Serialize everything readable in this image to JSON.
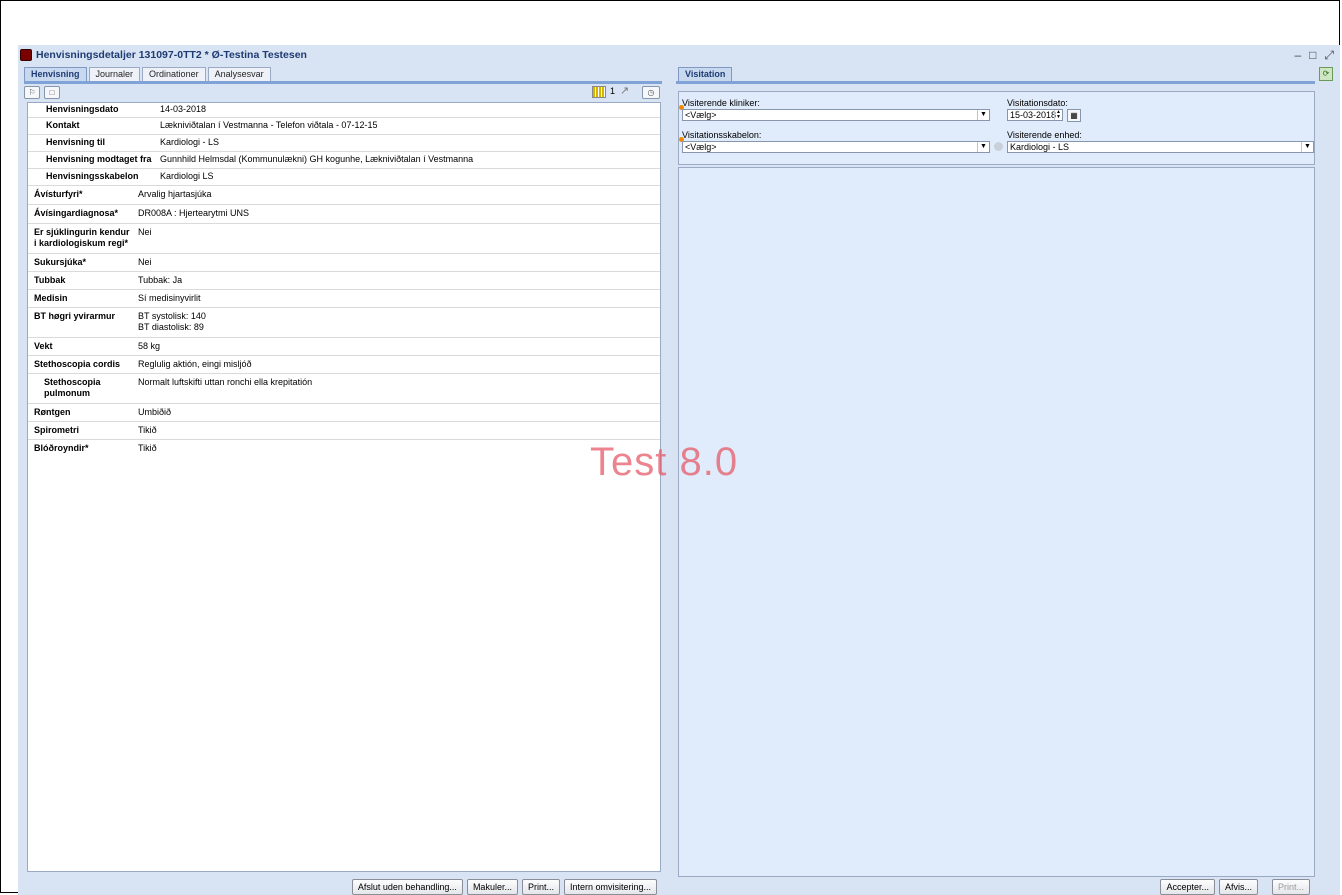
{
  "window": {
    "title": "Henvisningsdetaljer 131097-0TT2 * Ø-Testina Testesen",
    "controls": [
      "–",
      "□",
      "⤢"
    ]
  },
  "left_tabs": [
    "Henvisning",
    "Journaler",
    "Ordinationer",
    "Analysesvar"
  ],
  "right_tabs": [
    "Visitation"
  ],
  "toolbar": {
    "page": "1"
  },
  "details": [
    {
      "label": "Henvisningsdato",
      "value": "14-03-2018"
    },
    {
      "label": "Kontakt",
      "value": "Lækniviðtalan í Vestmanna - Telefon viðtala -  07-12-15"
    },
    {
      "label": "Henvisning til",
      "value": "Kardiologi - LS"
    },
    {
      "label": "Henvisning modtaget fra",
      "value": "Gunnhild Helmsdal (Kommunulækni) GH kogunhe, Lækniviðtalan í Vestmanna"
    },
    {
      "label": "Henvisningsskabelon",
      "value": "Kardiologi LS"
    },
    {
      "label": "Ávísturfyri*",
      "value": "Arvalig hjartasjúka"
    },
    {
      "label": "Ávísingardiagnosa*",
      "value": "DR008A : Hjertearytmi UNS"
    },
    {
      "label": "Er sjúklingurin kendur i kardiologiskum regi*",
      "value": "Nei"
    },
    {
      "label": "Sukursjúka*",
      "value": "Nei"
    },
    {
      "label": "Tubbak",
      "value": "Tubbak:  Ja"
    },
    {
      "label": "Medisin",
      "value": "Sí medisinyvirlit"
    },
    {
      "label": "BT høgri yvirarmur",
      "value": "BT systolisk:   140",
      "value2": "BT diastolisk:  89"
    },
    {
      "label": "Vekt",
      "value": "58  kg"
    },
    {
      "label": "Stethoscopia cordis",
      "value": "Reglulig aktión, eingi misljóð"
    },
    {
      "label": "Stethoscopia pulmonum",
      "value": "Normalt luftskifti uttan ronchi ella krepitatión"
    },
    {
      "label": "Røntgen",
      "value": "Umbiðið"
    },
    {
      "label": "Spirometri",
      "value": "Tikið"
    },
    {
      "label": "Blóðroyndir*",
      "value": "Tikið"
    }
  ],
  "left_buttons": [
    "Afslut uden behandling...",
    "Makuler...",
    "Print...",
    "Intern omvisitering..."
  ],
  "visitation": {
    "kliniker_label": "Visiterende kliniker:",
    "kliniker_value": "<Vælg>",
    "dato_label": "Visitationsdato:",
    "dato_value": "15-03-2018",
    "skabelon_label": "Visitationsskabelon:",
    "skabelon_value": "<Vælg>",
    "enhed_label": "Visiterende enhed:",
    "enhed_value": "Kardiologi - LS"
  },
  "right_buttons": [
    "Accepter...",
    "Afvis...",
    "Print..."
  ],
  "watermark": "Test 8.0",
  "colors": {
    "title": "#1f3b73",
    "panel": "#e0ecfb",
    "required_dot": "#f08a00",
    "watermark": "#e65c6a"
  }
}
